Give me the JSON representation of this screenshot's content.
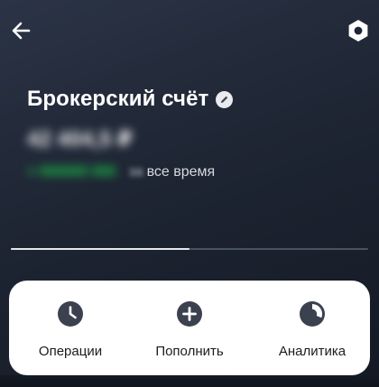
{
  "header": {
    "back_icon": "arrow-left-icon",
    "settings_icon": "hexagon-gear-icon"
  },
  "account": {
    "title": "Брокерский счёт",
    "edit_icon": "pencil-icon",
    "balance": "42 404,5 ₽",
    "profit": "+ 000000 000",
    "period_prefix": "за",
    "period_label": "все время"
  },
  "carousel": {
    "progress": 0.5
  },
  "actions": [
    {
      "label": "Операции",
      "icon": "clock-icon"
    },
    {
      "label": "Пополнить",
      "icon": "plus-circle-icon"
    },
    {
      "label": "Аналитика",
      "icon": "pie-chart-icon"
    }
  ],
  "colors": {
    "background": "#1e2533",
    "profit": "#17d449",
    "card": "#ffffff",
    "icon_dark": "#3c4150"
  }
}
